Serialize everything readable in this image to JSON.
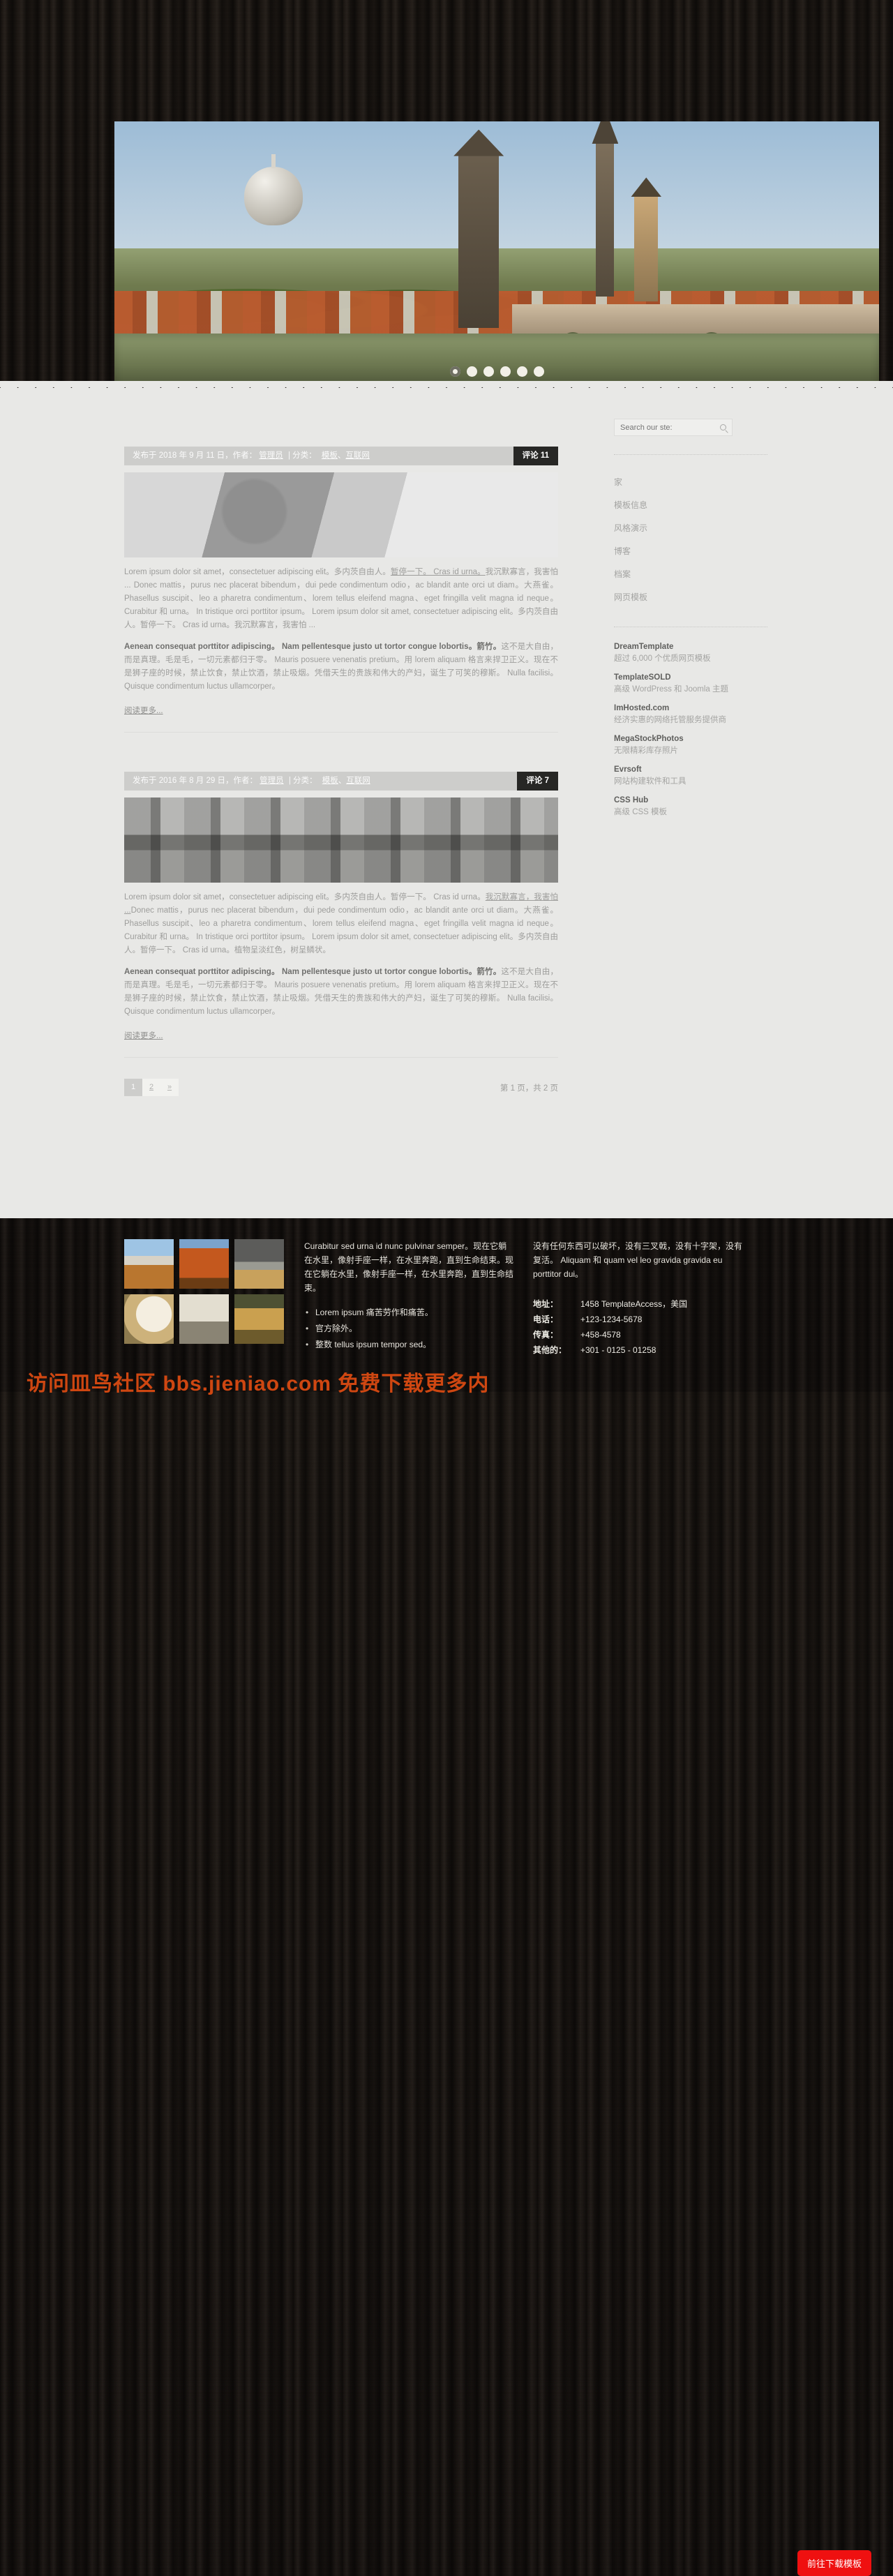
{
  "hero": {
    "alt": "prague-charles-bridge-banner",
    "slider_dots": 6,
    "active_dot": 1
  },
  "search": {
    "placeholder": "Search our ste:",
    "value": "",
    "icon": "search-icon"
  },
  "sidebar": {
    "nav": [
      {
        "label": "家"
      },
      {
        "label": "模板信息"
      },
      {
        "label": "风格演示"
      },
      {
        "label": "博客"
      },
      {
        "label": "档案"
      },
      {
        "label": "网页模板"
      }
    ],
    "sponsors": [
      {
        "title": "DreamTemplate",
        "desc": "超过 6,000 个优质网页模板"
      },
      {
        "title": "TemplateSOLD",
        "desc": "高级 WordPress 和 Joomla 主题"
      },
      {
        "title": "ImHosted.com",
        "desc": "经济实惠的网络托管服务提供商"
      },
      {
        "title": "MegaStockPhotos",
        "desc": "无限精彩库存照片"
      },
      {
        "title": "Evrsoft",
        "desc": "网站构建软件和工具"
      },
      {
        "title": "CSS Hub",
        "desc": "高级 CSS 模板"
      }
    ]
  },
  "posts": [
    {
      "meta_prefix": "发布于 2018 年 9 月 11 日，作者：",
      "author": "管理员",
      "cat_label": "| 分类：",
      "categories": [
        "模板",
        "互联网"
      ],
      "cat_sep": "、",
      "comments_label": "评论 11",
      "image": "woman-reading-grayscale",
      "p1_a": "Lorem ipsum dolor sit amet，consectetuer adipiscing elit。多内茨自由人。",
      "p1_u": "暂停一下。 Cras id urna。",
      "p1_b": "我沉默寡言，我害怕 ... Donec mattis，purus nec placerat bibendum，dui pede condimentum odio，ac blandit ante orci ut diam。大燕雀。 Phasellus suscipit、leo a pharetra condimentum、lorem tellus eleifend magna、eget fringilla velit magna id neque。 Curabitur 和 urna。 In tristique orci porttitor ipsum。 Lorem ipsum dolor sit amet, consectetuer adipiscing elit。多内茨自由人。暂停一下。 Cras id urna。我沉默寡言，我害怕 ...",
      "p2_bold": "Aenean consequat porttitor adipiscing。 Nam pellentesque justo ut tortor congue lobortis。箭竹。",
      "p2_rest": "这不是大自由，而是真理。毛是毛，一切元素都归于零。 Mauris posuere venenatis pretium。用 lorem aliquam 格言来捍卫正义。现在不是狮子座的时候，禁止饮食，禁止饮酒，禁止吸烟。凭借天生的贵族和伟大的产妇，诞生了可笑的穆斯。 Nulla facilisi。 Quisque condimentum luctus ullamcorper。",
      "read_more": "阅读更多..."
    },
    {
      "meta_prefix": "发布于 2016 年 8 月 29 日，作者：",
      "author": "管理员",
      "cat_label": "| 分类：",
      "categories": [
        "模板",
        "互联网"
      ],
      "cat_sep": "、",
      "comments_label": "评论 7",
      "image": "city-waterfront-grayscale",
      "p1_a": "Lorem ipsum dolor sit amet，consectetuer adipiscing elit。多内茨自由人。暂停一下。 Cras id urna。",
      "p1_u": "我沉默寡言，我害怕 ...",
      "p1_b": "Donec mattis，purus nec placerat bibendum，dui pede condimentum odio，ac blandit ante orci ut diam。大燕雀。 Phasellus suscipit、leo a pharetra condimentum、lorem tellus eleifend magna、eget fringilla velit magna id neque。 Curabitur 和 urna。 In tristique orci porttitor ipsum。 Lorem ipsum dolor sit amet, consectetuer adipiscing elit。多内茨自由人。暂停一下。 Cras id urna。植物呈淡红色，树呈鳞状。",
      "p2_bold": "Aenean consequat porttitor adipiscing。 Nam pellentesque justo ut tortor congue lobortis。箭竹。",
      "p2_rest": "这不是大自由，而是真理。毛是毛，一切元素都归于零。 Mauris posuere venenatis pretium。用 lorem aliquam 格言来捍卫正义。现在不是狮子座的时候，禁止饮食，禁止饮酒，禁止吸烟。凭借天生的贵族和伟大的产妇，诞生了可笑的穆斯。 Nulla facilisi。 Quisque condimentum luctus ullamcorper。",
      "read_more": "阅读更多..."
    }
  ],
  "pagination": {
    "pages": [
      "1",
      "2"
    ],
    "next_label": "»",
    "current": "1",
    "info": "第 1 页，共 2 页"
  },
  "footer": {
    "gallery": [
      "city-skyline-thumb",
      "autumn-forest-thumb",
      "vintage-car-thumb",
      "white-flowers-thumb",
      "steampunk-thumb",
      "velvet-thumb"
    ],
    "about_text": "Curabitur sed urna id nunc pulvinar semper。现在它躺在水里，像射手座一样，在水里奔跑，直到生命结束。现在它躺在水里，像射手座一样，在水里奔跑，直到生命结束。",
    "bullets": [
      "Lorem ipsum 痛苦劳作和痛苦。",
      "官方除外。",
      "整数 tellus ipsum tempor sed。"
    ],
    "right_text": "没有任何东西可以破坏，没有三叉戟，没有十字架，没有复活。 Aliquam 和 quam vel leo gravida gravida eu porttitor dui。",
    "contact": [
      {
        "key": "地址：",
        "value": "1458 TemplateAccess，美国"
      },
      {
        "key": "电话：",
        "value": "+123-1234-5678"
      },
      {
        "key": "传真：",
        "value": "+458-4578"
      },
      {
        "key": "其他的：",
        "value": "+301 - 0125 - 01258"
      }
    ],
    "download_button": "前往下载模板",
    "watermark": "访问皿鸟社区 bbs.jieniao.com 免费下载更多内"
  },
  "colors": {
    "accent_red": "#ef1010",
    "meta_bar": "#cdcdcb",
    "comments_bar": "#272725",
    "band_bg": "#e8e8e6"
  }
}
